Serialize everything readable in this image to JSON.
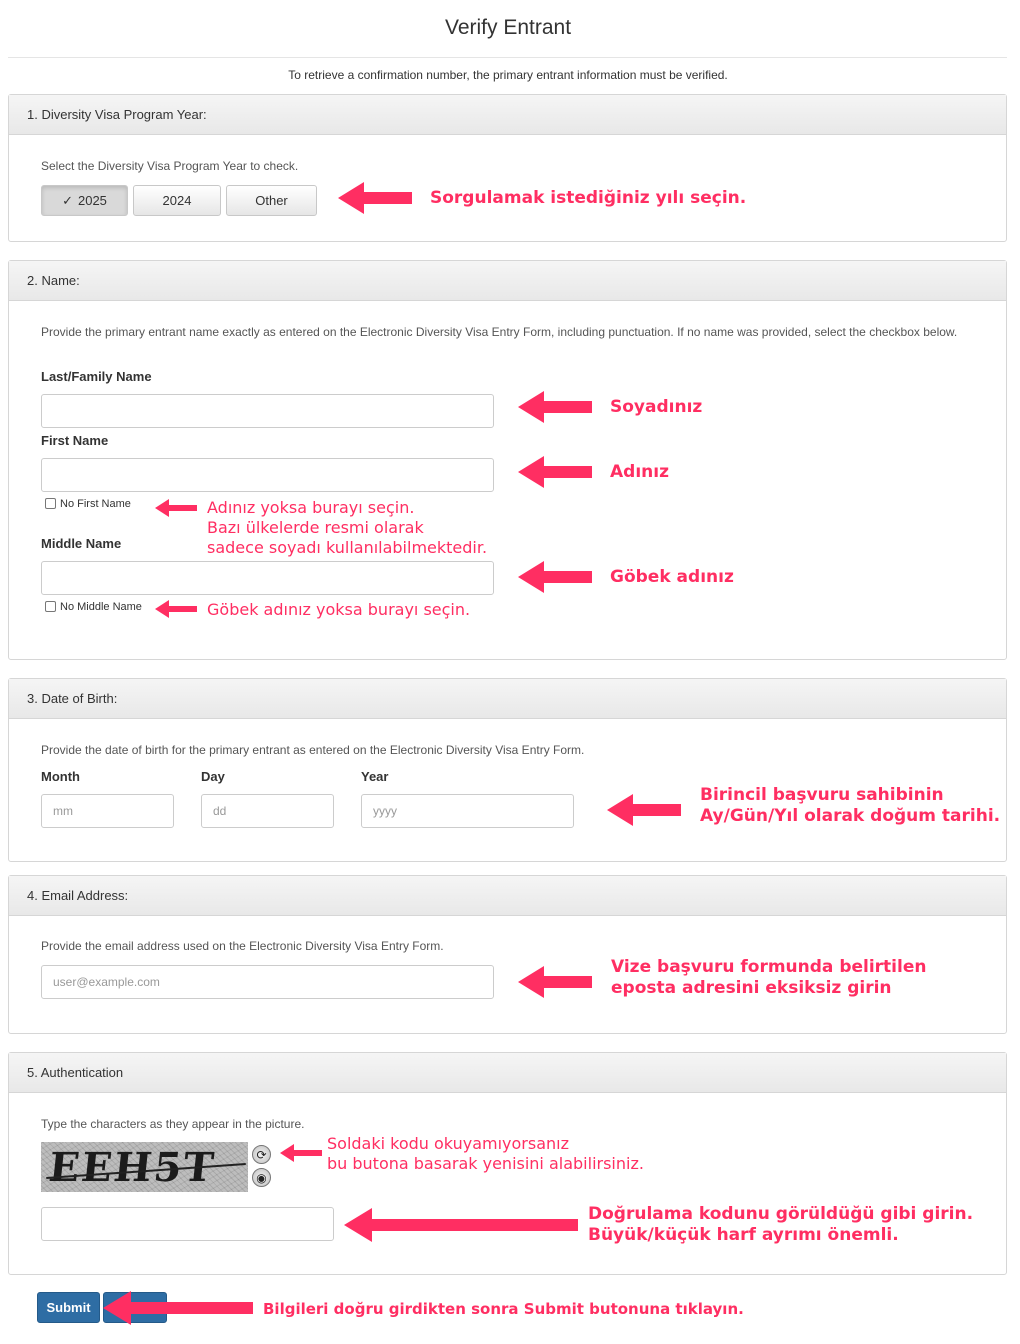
{
  "page": {
    "title": "Verify Entrant",
    "intro": "To retrieve a confirmation number, the primary entrant information must be verified."
  },
  "sections": {
    "year": {
      "heading": "1. Diversity Visa Program Year:",
      "help": "Select the Diversity Visa Program Year to check.",
      "options": [
        "2025",
        "2024",
        "Other"
      ],
      "selected": "2025",
      "check_glyph": "✓"
    },
    "name": {
      "heading": "2. Name:",
      "help": "Provide the primary entrant name exactly as entered on the Electronic Diversity Visa Entry Form, including punctuation. If no name was provided, select the checkbox below.",
      "last_label": "Last/Family Name",
      "first_label": "First Name",
      "no_first_label": "No First Name",
      "middle_label": "Middle Name",
      "no_middle_label": "No Middle Name"
    },
    "dob": {
      "heading": "3. Date of Birth:",
      "help": "Provide the date of birth for the primary entrant as entered on the Electronic Diversity Visa Entry Form.",
      "month_label": "Month",
      "day_label": "Day",
      "year_label": "Year",
      "month_placeholder": "mm",
      "day_placeholder": "dd",
      "year_placeholder": "yyyy"
    },
    "email": {
      "heading": "4. Email Address:",
      "help": "Provide the email address used on the Electronic Diversity Visa Entry Form.",
      "placeholder": "user@example.com"
    },
    "auth": {
      "heading": "5. Authentication",
      "help": "Type the characters as they appear in the picture.",
      "captcha_text": "EEH5T",
      "refresh_glyph": "⟳",
      "audio_glyph": "◉"
    }
  },
  "submit_label": "Submit",
  "annotations": {
    "year": "Sorgulamak istediğiniz yılı seçin.",
    "last": "Soyadınız",
    "first": "Adınız",
    "no_first": [
      "Adınız yoksa burayı seçin.",
      "Bazı ülkelerde resmi olarak",
      "sadece soyadı kullanılabilmektedir."
    ],
    "middle": "Göbek adınız",
    "no_middle": "Göbek adınız yoksa burayı seçin.",
    "dob": [
      "Birincil başvuru sahibinin",
      "Ay/Gün/Yıl olarak doğum tarihi."
    ],
    "email": [
      "Vize başvuru formunda belirtilen",
      "eposta adresini eksiksiz girin"
    ],
    "captcha": [
      "Soldaki kodu okuyamıyorsanız",
      "bu butona basarak yenisini alabilirsiniz."
    ],
    "code": [
      "Doğrulama kodunu görüldüğü gibi girin.",
      "Büyük/küçük harf ayrımı önemli."
    ],
    "submit": "Bilgileri doğru girdikten sonra Submit butonuna tıklayın."
  },
  "colors": {
    "annotation": "#ff2e62",
    "submit_bg": "#2e6da4",
    "panel_border": "#d6d6d6"
  }
}
